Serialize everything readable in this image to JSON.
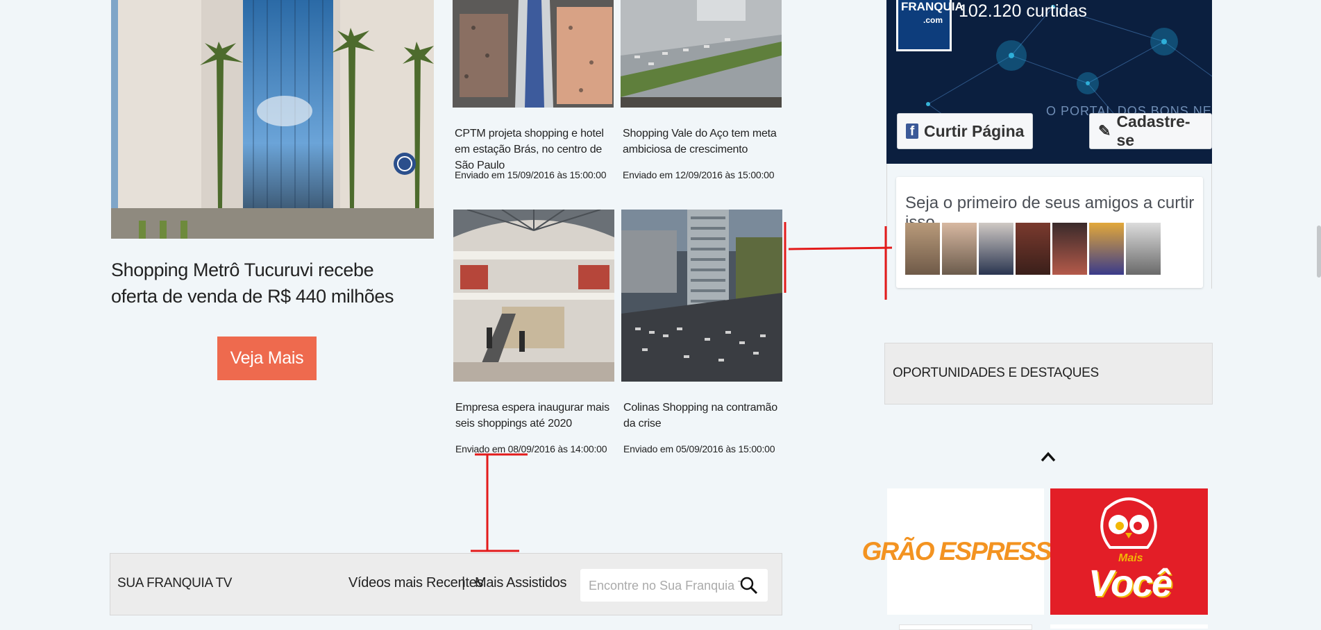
{
  "featured": {
    "title": "Shopping Metrô Tucuruvi recebe oferta de venda de R$ 440 milhões",
    "button_label": "Veja Mais"
  },
  "articles": [
    {
      "title": "CPTM projeta shopping e hotel em estação Brás, no centro de São Paulo",
      "date": "Enviado em 15/09/2016 às 15:00:00"
    },
    {
      "title": "Shopping Vale do Aço tem meta ambiciosa de crescimento",
      "date": "Enviado em 12/09/2016 às 15:00:00"
    },
    {
      "title": "Empresa espera inaugurar mais seis shoppings até 2020",
      "date": "Enviado em 08/09/2016 às 14:00:00"
    },
    {
      "title": "Colinas Shopping na contramão da crise",
      "date": "Enviado em 05/09/2016 às 15:00:00"
    }
  ],
  "facebook": {
    "page_logo": "FRANQUIA",
    "page_logo_suffix": ".com",
    "likes": "102.120 curtidas",
    "portal_text": "O PORTAL DOS BONS NEGÓCIOS",
    "like_button": "Curtir Página",
    "signup_button": "Cadastre-se",
    "social_text": "Seja o primeiro de seus amigos a curtir isso."
  },
  "opportunities": {
    "title": "OPORTUNIDADES E DESTAQUES"
  },
  "ads": {
    "grao_espresso": "GRÃO ESPRESSO",
    "mais_voce_small": "Mais",
    "mais_voce_big": "Você"
  },
  "tv": {
    "title": "SUA FRANQUIA TV",
    "recent_label": "Vídeos mais Recentes",
    "separator": "|",
    "most_watched_label": "Mais Assistidos",
    "search_placeholder": "Encontre no Sua Franquia TV"
  },
  "colors": {
    "accent": "#ee6a4e",
    "page_bg": "#f1f6f9",
    "annotation": "#e31b1b",
    "ad_red": "#e31e27",
    "ad_orange": "#f39321"
  },
  "icons": [
    "search-icon",
    "facebook-icon",
    "pencil-icon",
    "chevron-up-icon"
  ]
}
